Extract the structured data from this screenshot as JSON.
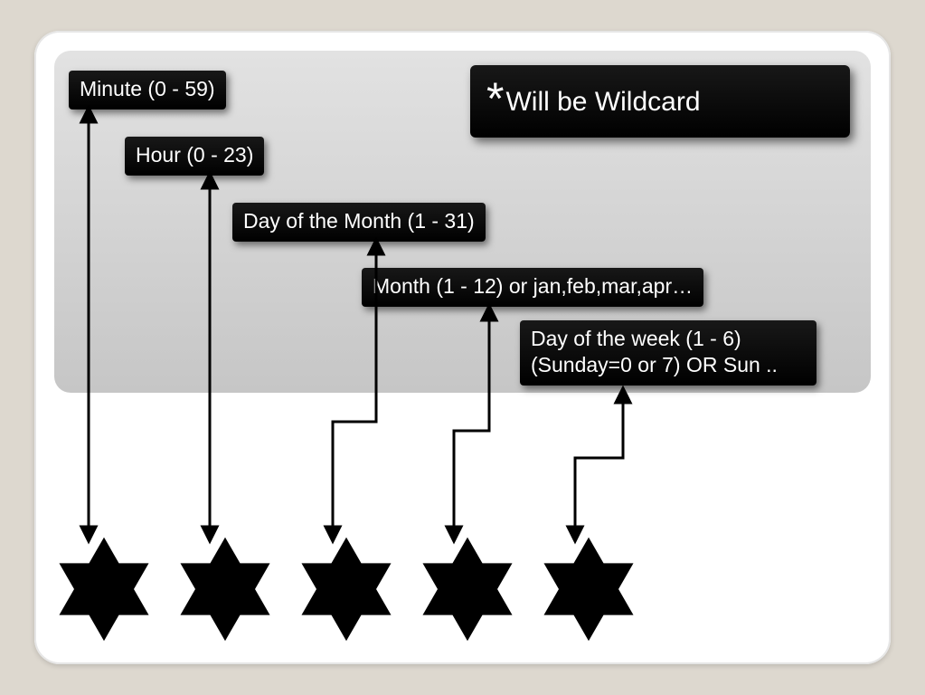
{
  "wildcard": {
    "symbol": "*",
    "text": "Will be Wildcard"
  },
  "labels": {
    "minute": "Minute (0  - 59)",
    "hour": "Hour (0  - 23)",
    "dom": "Day of the Month (1  - 31)",
    "month": "Month (1  - 12) or jan,feb,mar,apr…",
    "dow": "Day of the week (1  - 6) (Sunday=0 or 7) OR Sun .."
  }
}
